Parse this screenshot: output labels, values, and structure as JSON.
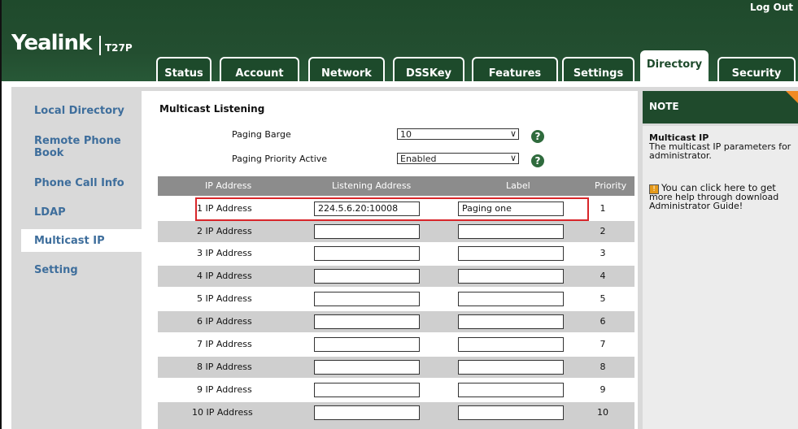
{
  "header": {
    "logo": "Yealink",
    "model": "T27P",
    "logout": "Log Out"
  },
  "tabs": [
    {
      "label": "Status"
    },
    {
      "label": "Account"
    },
    {
      "label": "Network"
    },
    {
      "label": "DSSKey"
    },
    {
      "label": "Features"
    },
    {
      "label": "Settings"
    },
    {
      "label": "Directory",
      "active": true
    },
    {
      "label": "Security"
    }
  ],
  "sidebar": {
    "items": [
      {
        "label": "Local Directory"
      },
      {
        "label": "Remote Phone Book"
      },
      {
        "label": "Phone Call Info"
      },
      {
        "label": "LDAP"
      },
      {
        "label": "Multicast IP",
        "active": true
      },
      {
        "label": "Setting"
      }
    ]
  },
  "main": {
    "section_title": "Multicast Listening",
    "paging_barge_label": "Paging Barge",
    "paging_barge_value": "10",
    "paging_priority_label": "Paging Priority Active",
    "paging_priority_value": "Enabled",
    "help_glyph": "?",
    "table": {
      "headers": [
        "IP Address",
        "Listening Address",
        "Label",
        "Priority"
      ],
      "rows": [
        {
          "label": "1  IP Address",
          "address": "224.5.6.20:10008",
          "name": "Paging one",
          "priority": "1"
        },
        {
          "label": "2  IP Address",
          "address": "",
          "name": "",
          "priority": "2"
        },
        {
          "label": "3  IP Address",
          "address": "",
          "name": "",
          "priority": "3"
        },
        {
          "label": "4  IP Address",
          "address": "",
          "name": "",
          "priority": "4"
        },
        {
          "label": "5  IP Address",
          "address": "",
          "name": "",
          "priority": "5"
        },
        {
          "label": "6  IP Address",
          "address": "",
          "name": "",
          "priority": "6"
        },
        {
          "label": "7  IP Address",
          "address": "",
          "name": "",
          "priority": "7"
        },
        {
          "label": "8  IP Address",
          "address": "",
          "name": "",
          "priority": "8"
        },
        {
          "label": "9  IP Address",
          "address": "",
          "name": "",
          "priority": "9"
        },
        {
          "label": "10  IP Address",
          "address": "",
          "name": "",
          "priority": "10"
        }
      ]
    }
  },
  "note": {
    "title": "NOTE",
    "heading": "Multicast IP",
    "line1": "The multicast IP parameters for",
    "line2": "administrator.",
    "help1": "You can click here to get",
    "help2": "more help through download",
    "help3": "Administrator Guide!",
    "help_icon": "!"
  },
  "colors": {
    "brand_green": "#1f4a2c",
    "link_blue": "#3e6e9c",
    "highlight_red": "#d8262a",
    "note_corner": "#f08a24"
  }
}
